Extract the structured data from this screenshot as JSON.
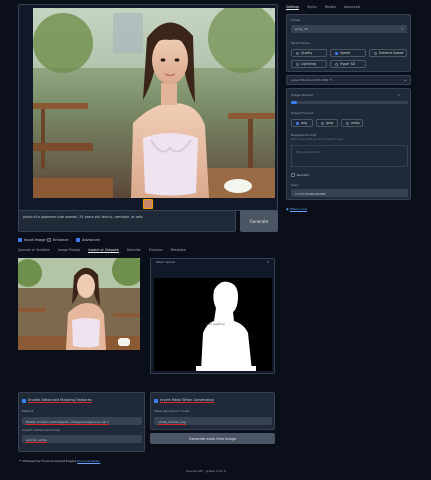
{
  "generated_image": {
    "alt": "Generated photo of a Japanese woman at a cafe"
  },
  "prompt": {
    "value": "photo of a japanese cute woman, 25 years old, skinny, camisole, at cafe"
  },
  "generate_button": "Generate",
  "options": [
    {
      "label": "Input Image",
      "checked": true
    },
    {
      "label": "Enhance",
      "checked": false
    },
    {
      "label": "Advanced",
      "checked": true
    }
  ],
  "input_tabs": [
    "Upscale or Variation",
    "Image Prompt",
    "Inpaint or Outpaint",
    "Describe",
    "Enhance",
    "Metadata"
  ],
  "mask_panel": {
    "title": "Mask Upload",
    "mask_text": "dont painting"
  },
  "inpaint": {
    "enable_advanced_label": "Enable Advanced Masking Features",
    "method_label": "Method",
    "method_value": "Modify Content (add objects, change background, etc.)",
    "additional_prompt_label": "Inpaint Additional Prompt",
    "additional_prompt_value": "woman, smile",
    "invert_mask_label": "Invert Mask When Generating",
    "mask_model_label": "Mask generation model",
    "mask_model_value": "u2net_human_seg",
    "generate_mask_button": "Generate mask from image"
  },
  "footer_note": "** Powered by Fooocus Inpaint Engine",
  "footer_link": "Documentation",
  "bottom_credits": "Use via API  ·  gradio 4.31.5",
  "settings_tabs": [
    "Settings",
    "Styles",
    "Models",
    "Advanced"
  ],
  "preset": {
    "label": "Preset",
    "value": "pony_v6"
  },
  "performance": {
    "label": "Performance",
    "items": [
      "Quality",
      "Speed",
      "Extreme Speed",
      "Lightning",
      "Hyper SD"
    ],
    "selected": "Speed"
  },
  "aspect_ratios": {
    "label": "Aspect Ratios 1152×896  ⁹⁄₇"
  },
  "image_number": {
    "label": "Image Number",
    "value": "1",
    "fraction": 0.05
  },
  "output_format": {
    "label": "Output Format",
    "items": [
      "png",
      "jpeg",
      "webp"
    ],
    "selected": "png"
  },
  "negative_prompt": {
    "label": "Negative Prompt",
    "info": "Describing what you do not want to see.",
    "placeholder": "Type prompt here."
  },
  "random": {
    "label": "Random",
    "checked": false
  },
  "seed": {
    "label": "Seed",
    "value": "1771579186184984"
  },
  "history_log": "History Log"
}
